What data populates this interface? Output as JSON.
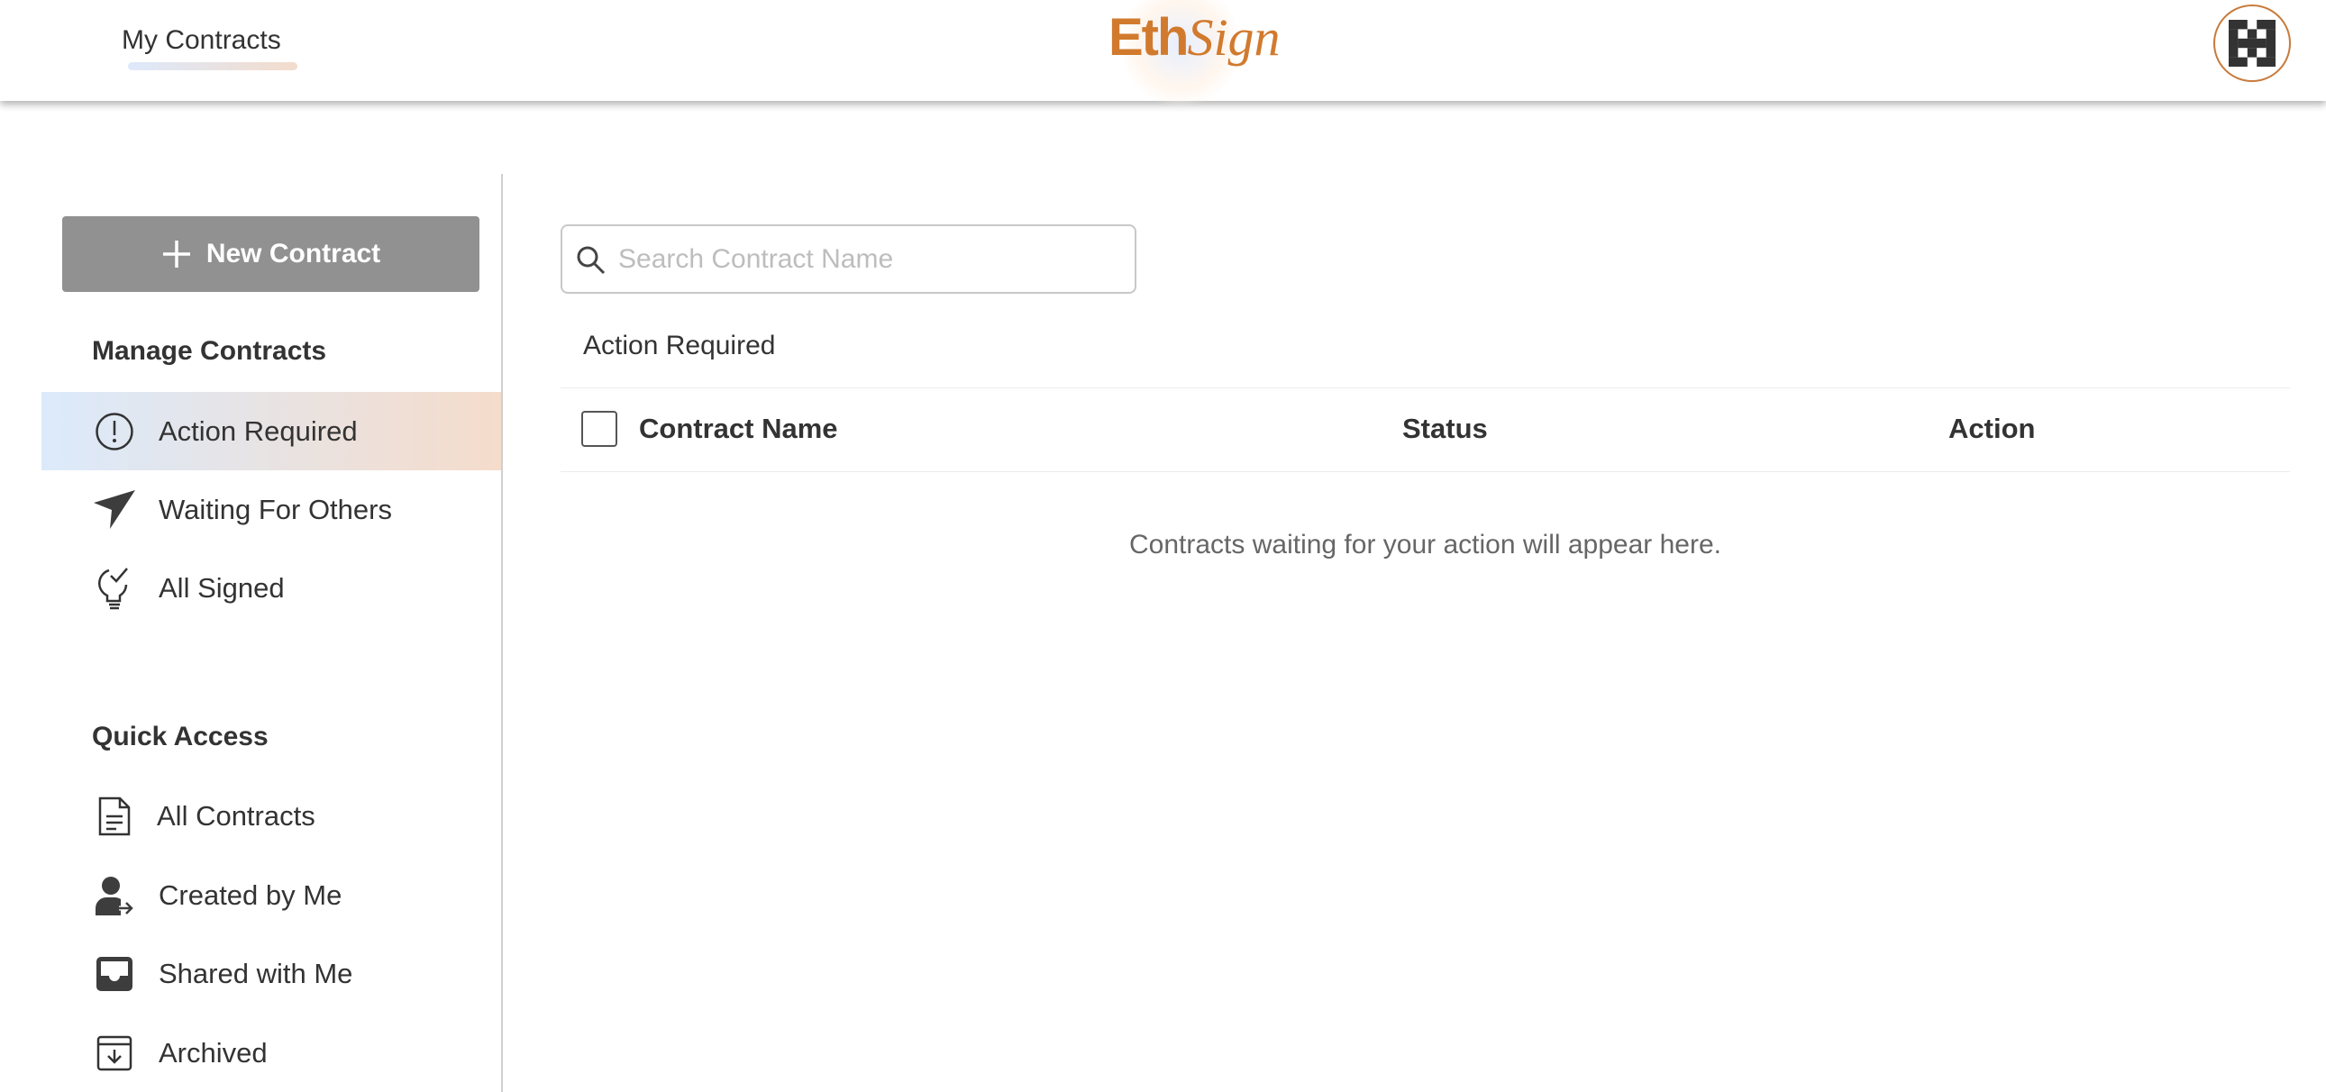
{
  "header": {
    "nav_tab": "My Contracts",
    "logo_text": "EthSign",
    "logo_eth": "Eth",
    "logo_sign": "Sign",
    "accent": "#d17a2e"
  },
  "sidebar": {
    "new_contract_label": "New Contract",
    "manage_title": "Manage Contracts",
    "manage_items": [
      {
        "label": "Action Required",
        "icon": "exclamation-circle-icon",
        "active": true
      },
      {
        "label": "Waiting For Others",
        "icon": "paper-plane-icon"
      },
      {
        "label": "All Signed",
        "icon": "lightbulb-check-icon"
      }
    ],
    "quick_title": "Quick Access",
    "quick_items": [
      {
        "label": "All Contracts",
        "icon": "document-icon"
      },
      {
        "label": "Created by Me",
        "icon": "user-arrow-icon"
      },
      {
        "label": "Shared with Me",
        "icon": "inbox-icon"
      },
      {
        "label": "Archived",
        "icon": "archive-icon"
      }
    ]
  },
  "main": {
    "search_placeholder": "Search Contract Name",
    "search_value": "",
    "section_title": "Action Required",
    "columns": [
      "Contract Name",
      "Status",
      "Action"
    ],
    "empty_message": "Contracts waiting for your action will appear here."
  }
}
